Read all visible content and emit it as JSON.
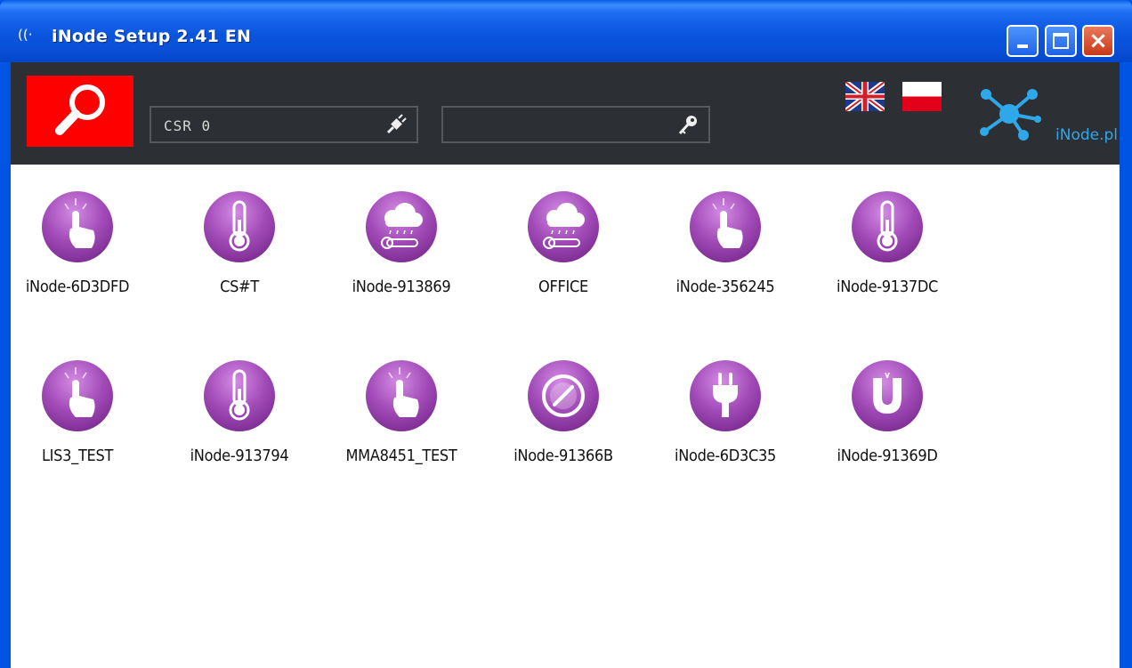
{
  "window": {
    "title": "iNode Setup 2.41 EN",
    "app_icon": "((·",
    "buttons": {
      "minimize": "minimize-icon",
      "maximize": "maximize-icon",
      "close": "×"
    }
  },
  "toolbar": {
    "search_button_icon": "magnifier-icon",
    "port_field": {
      "value": "CSR 0",
      "icon": "plug-icon"
    },
    "key_field": {
      "value": "",
      "icon": "key-icon"
    },
    "languages": [
      "uk-flag-icon",
      "poland-flag-icon"
    ],
    "logo_text": "iNode.pl"
  },
  "colors": {
    "accent_red": "#ff0000",
    "toolbar_bg": "#2c2f33",
    "device_icon": "#9b3fb0",
    "logo_blue": "#2fa8ea"
  },
  "devices": [
    {
      "label": "iNode-6D3DFD",
      "icon": "touch-icon"
    },
    {
      "label": "CS#T",
      "icon": "thermometer-icon"
    },
    {
      "label": "iNode-913869",
      "icon": "weather-icon"
    },
    {
      "label": "OFFICE",
      "icon": "weather-icon"
    },
    {
      "label": "iNode-356245",
      "icon": "touch-icon"
    },
    {
      "label": "iNode-9137DC",
      "icon": "thermometer-icon"
    },
    {
      "label": "LIS3_TEST",
      "icon": "touch-icon"
    },
    {
      "label": "iNode-913794",
      "icon": "thermometer-icon"
    },
    {
      "label": "MMA8451_TEST",
      "icon": "touch-icon"
    },
    {
      "label": "iNode-91366B",
      "icon": "compass-icon"
    },
    {
      "label": "iNode-6D3C35",
      "icon": "plug-icon"
    },
    {
      "label": "iNode-91369D",
      "icon": "magnet-icon"
    }
  ]
}
